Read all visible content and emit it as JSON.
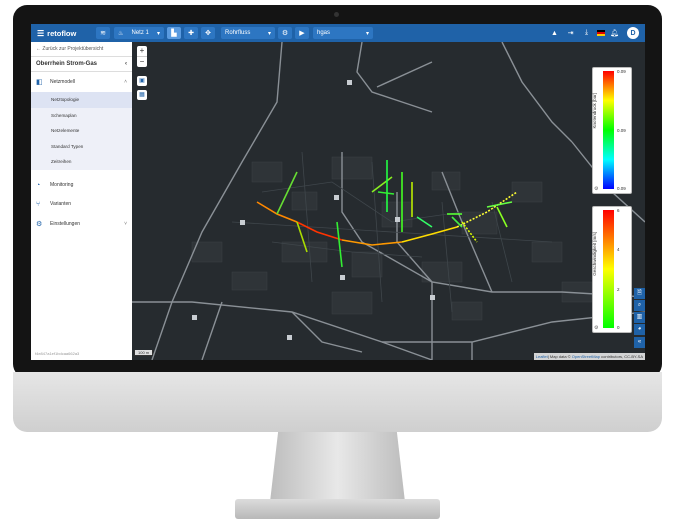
{
  "app": {
    "name": "retoflow"
  },
  "toolbar": {
    "network_select": "Netz 1",
    "element_select": "Rohrfluss",
    "medium_select": "hgas"
  },
  "sidebar": {
    "back_link": "← Zurück zur Projektübersicht",
    "project_title": "Oberrhein Strom-Gas",
    "collapse_glyph": "‹",
    "items": [
      {
        "label": "Netzmodell",
        "icon": "network-model-icon",
        "expanded": true
      },
      {
        "label": "Monitoring",
        "icon": "gauge-icon"
      },
      {
        "label": "Varianten",
        "icon": "branch-icon"
      },
      {
        "label": "Einstellungen",
        "icon": "gear-icon",
        "has_submenu": true
      }
    ],
    "subitems": [
      "Netztopologie",
      "Schemaplan",
      "Netzelemente",
      "Standard Typen",
      "Zeitreihen"
    ],
    "selected_subitem": "Netztopologie",
    "version": "f4e847a1ef1bdcaa662a3"
  },
  "user": {
    "initial": "D",
    "language_flag": "de"
  },
  "map": {
    "scale_label": "100 m",
    "attribution": {
      "leaflet": "Leaflet",
      "text": "| Map data © ",
      "osm": "OpenStreetMap",
      "rest": " contributors, CC-BY-SA"
    }
  },
  "legends": {
    "pressure": {
      "title": "Knotendruck [bar]",
      "ticks": [
        "0.09",
        "0.09",
        "0.09"
      ],
      "colors": [
        "#ff0000",
        "#ffff00",
        "#00ff00",
        "#00ffff",
        "#0000ff"
      ]
    },
    "velocity": {
      "title": "Geschwindigkeit [m/s]",
      "ticks": [
        "6",
        "4",
        "2",
        "0"
      ],
      "colors": [
        "#ff0000",
        "#ffff00",
        "#00ff00"
      ]
    }
  },
  "colors": {
    "accent": "#1f62a8",
    "map_bg": "#262b2f"
  }
}
